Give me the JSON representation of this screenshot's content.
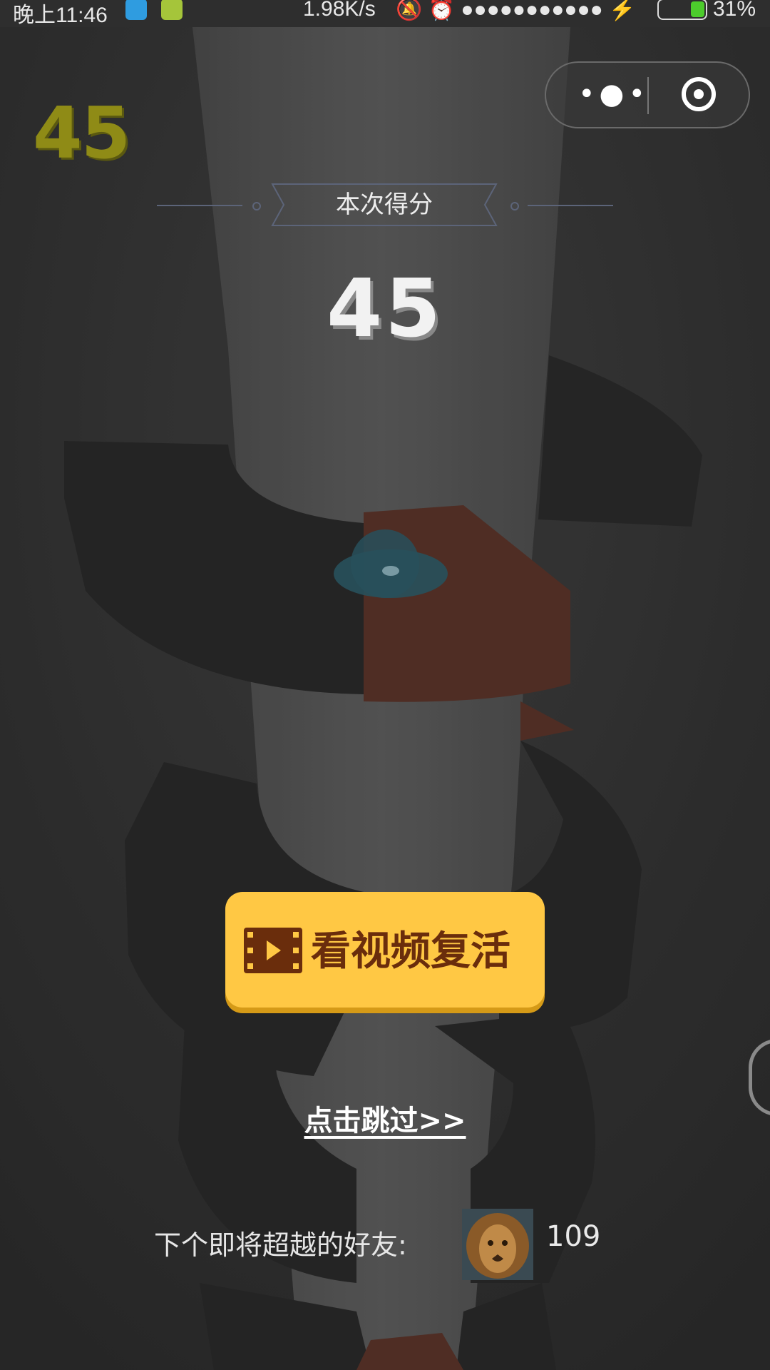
{
  "status_bar": {
    "time": "晚上11:46",
    "net_speed": "1.98K/s",
    "right_icons": "🔕 ⏰ ●●●●●●●●●●● ⚡",
    "battery_percent": "31%",
    "battery_level": 0.31,
    "icons": [
      "usb-icon",
      "android-icon",
      "mute-bell-icon",
      "alarm-icon",
      "wifi-icon",
      "signal-icon",
      "charging-icon",
      "battery-icon"
    ]
  },
  "capsule": {
    "menu_glyph": "•●•",
    "icons": [
      "more-dots-icon",
      "close-target-icon"
    ]
  },
  "game": {
    "corner_score": "45",
    "result_title": "本次得分",
    "score": "45",
    "revive_button": "看视频复活",
    "skip_link": "点击跳过>>",
    "next_friend_label": "下个即将超越的好友:",
    "next_friend_score": "109"
  },
  "colors": {
    "background": "#363636",
    "corner_score": "#8f8b16",
    "revive_button": "#ffc844",
    "revive_text": "#6a2d0c",
    "platform_dark": "#2a2a2a",
    "platform_danger": "#5a342a",
    "tower": "#555555",
    "ball_splash": "#2e5c68"
  }
}
